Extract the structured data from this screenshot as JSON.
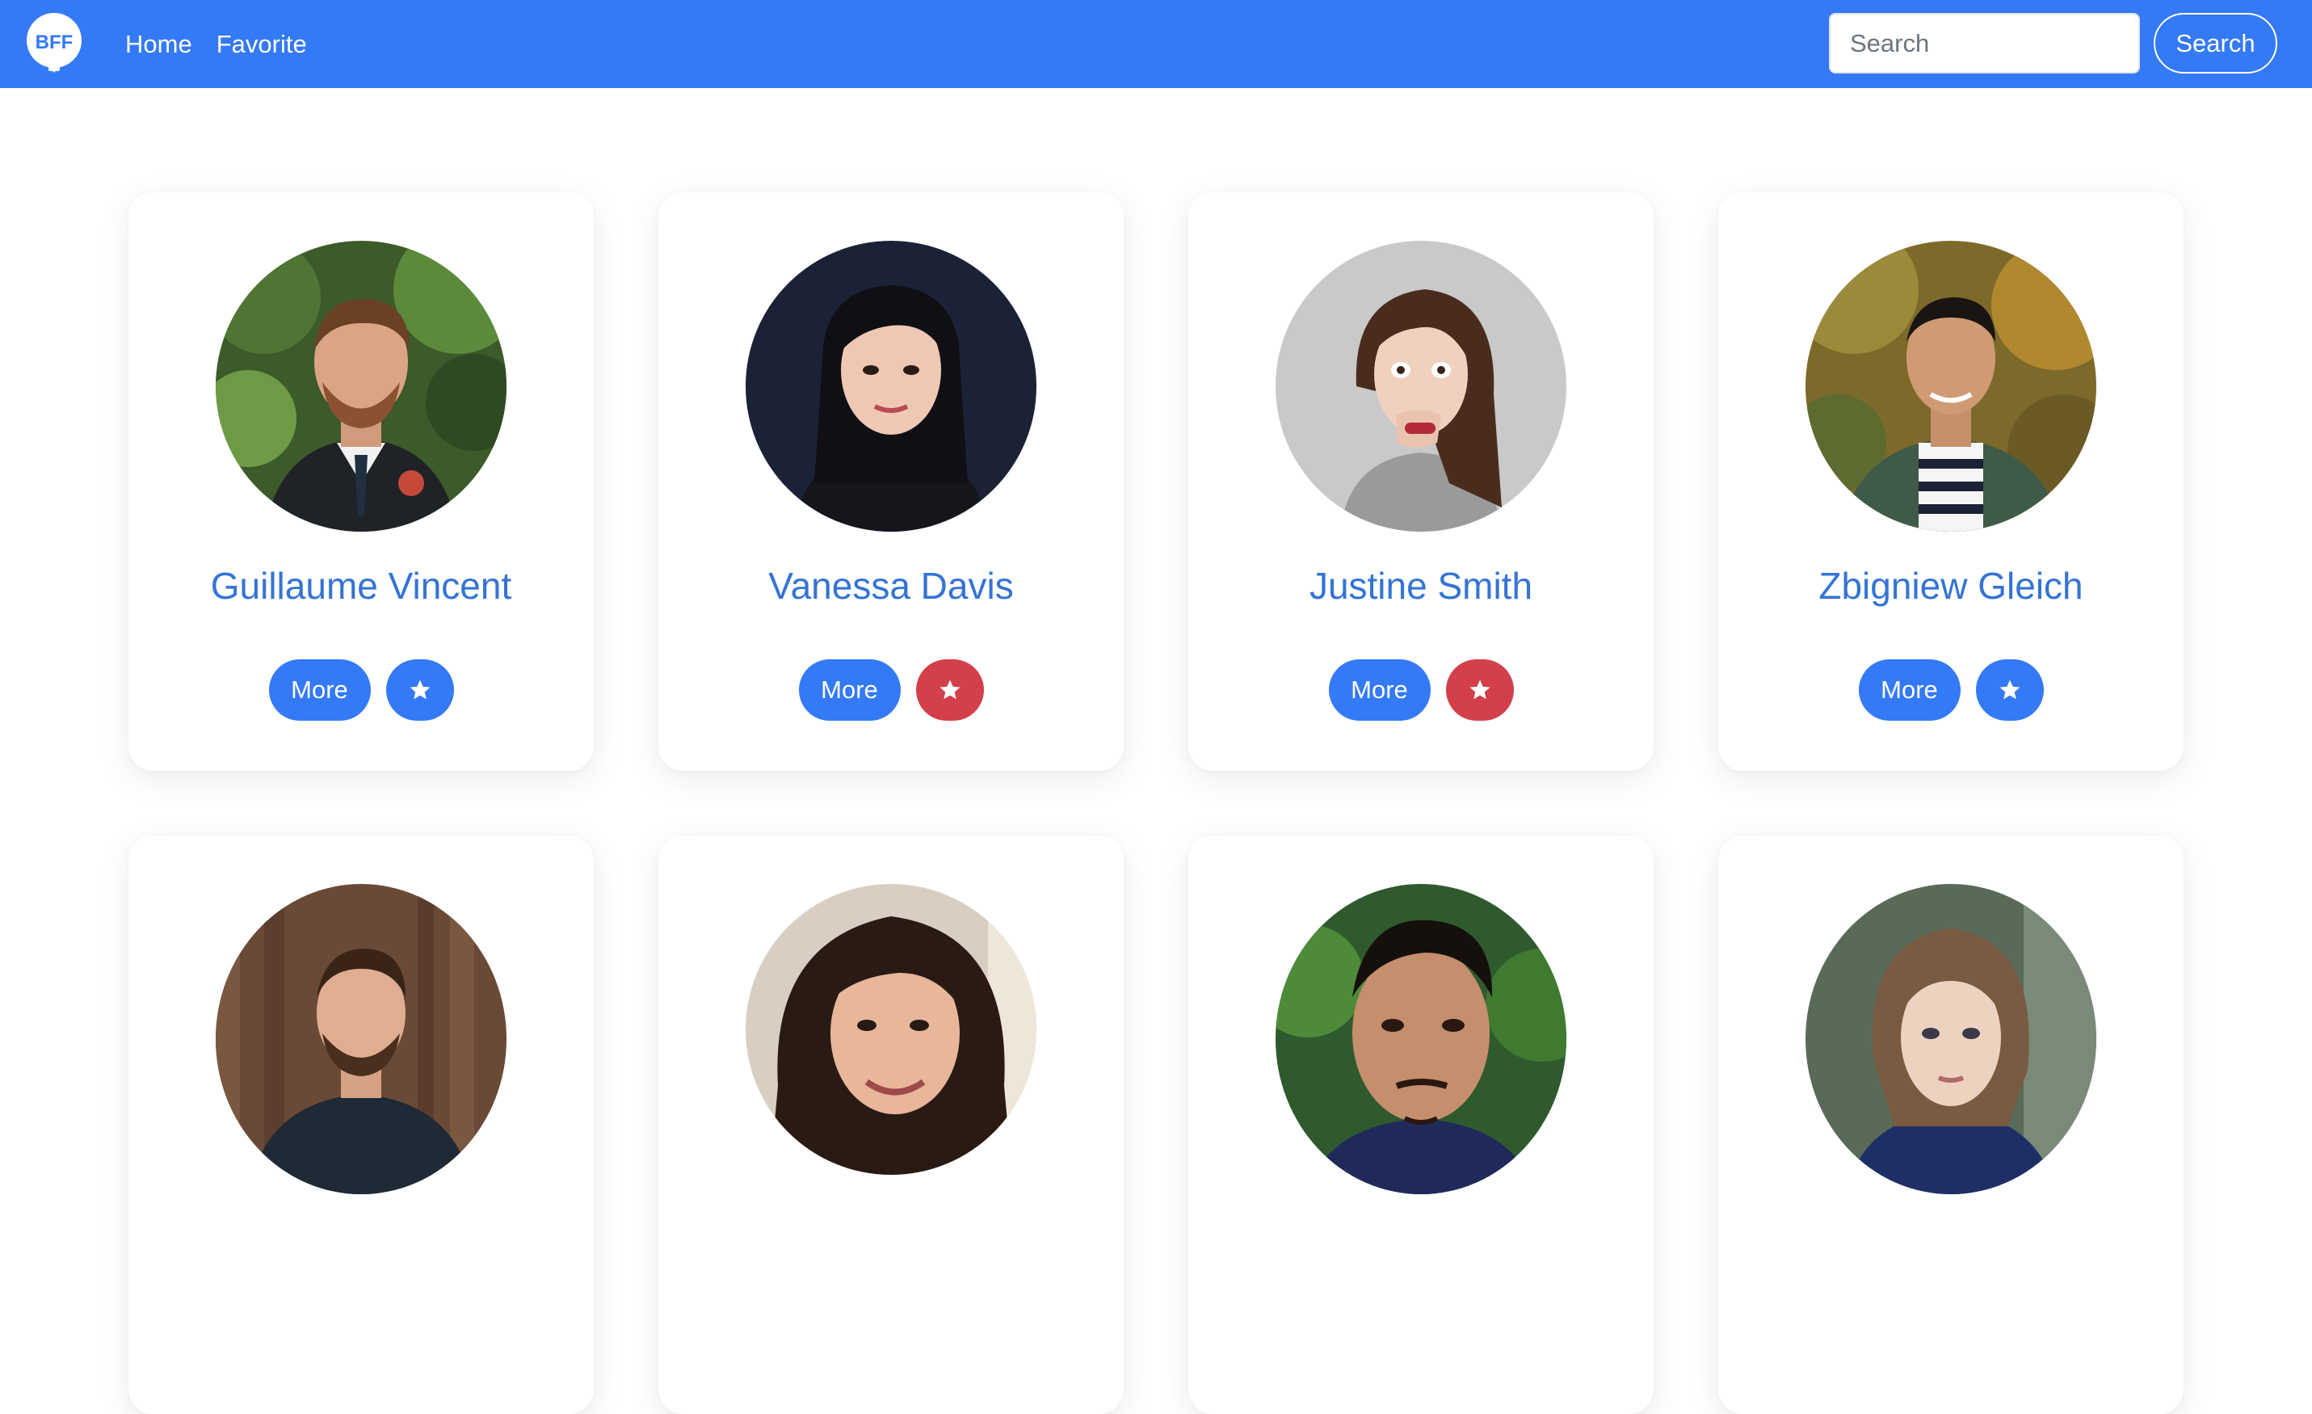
{
  "colors": {
    "brand": "#3479F6",
    "name_text": "#3474D4",
    "favorite_active": "#D33F4A",
    "favorite_inactive": "#3479F6"
  },
  "navbar": {
    "logo_text": "BFF",
    "logo_icon": "speech-bubble-logo-icon",
    "links": [
      {
        "label": "Home"
      },
      {
        "label": "Favorite"
      }
    ],
    "search": {
      "placeholder": "Search",
      "value": "",
      "button_label": "Search"
    }
  },
  "cards": [
    {
      "name": "Guillaume Vincent",
      "more_label": "More",
      "favorited": false,
      "star_icon": "star-icon"
    },
    {
      "name": "Vanessa Davis",
      "more_label": "More",
      "favorited": true,
      "star_icon": "star-icon"
    },
    {
      "name": "Justine Smith",
      "more_label": "More",
      "favorited": true,
      "star_icon": "star-icon"
    },
    {
      "name": "Zbigniew Gleich",
      "more_label": "More",
      "favorited": false,
      "star_icon": "star-icon"
    },
    {
      "name": "",
      "more_label": "",
      "favorited": false,
      "star_icon": "star-icon"
    },
    {
      "name": "",
      "more_label": "",
      "favorited": false,
      "star_icon": "star-icon"
    },
    {
      "name": "",
      "more_label": "",
      "favorited": false,
      "star_icon": "star-icon"
    },
    {
      "name": "",
      "more_label": "",
      "favorited": false,
      "star_icon": "star-icon"
    }
  ]
}
